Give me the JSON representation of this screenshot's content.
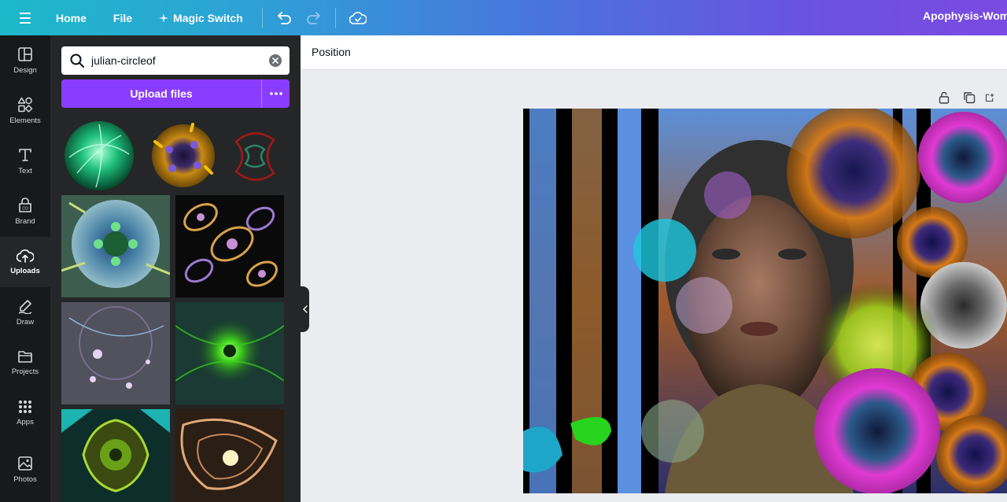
{
  "topbar": {
    "home": "Home",
    "file": "File",
    "magic_switch": "Magic Switch",
    "design_title": "Apophysis-Womar"
  },
  "rail": {
    "items": [
      {
        "label": "Design",
        "icon": "design-icon"
      },
      {
        "label": "Elements",
        "icon": "elements-icon"
      },
      {
        "label": "Text",
        "icon": "text-icon"
      },
      {
        "label": "Brand",
        "icon": "brand-icon"
      },
      {
        "label": "Uploads",
        "icon": "uploads-icon",
        "active": true
      },
      {
        "label": "Draw",
        "icon": "draw-icon"
      },
      {
        "label": "Projects",
        "icon": "projects-icon"
      },
      {
        "label": "Apps",
        "icon": "apps-icon"
      },
      {
        "label": "Photos",
        "icon": "photos-icon"
      }
    ]
  },
  "panel": {
    "search_value": "julian-circleof",
    "upload_label": "Upload files"
  },
  "context_bar": {
    "position": "Position"
  },
  "colors": {
    "accent": "#8b3dff",
    "rail_bg": "#18191b",
    "panel_bg": "#252627"
  }
}
